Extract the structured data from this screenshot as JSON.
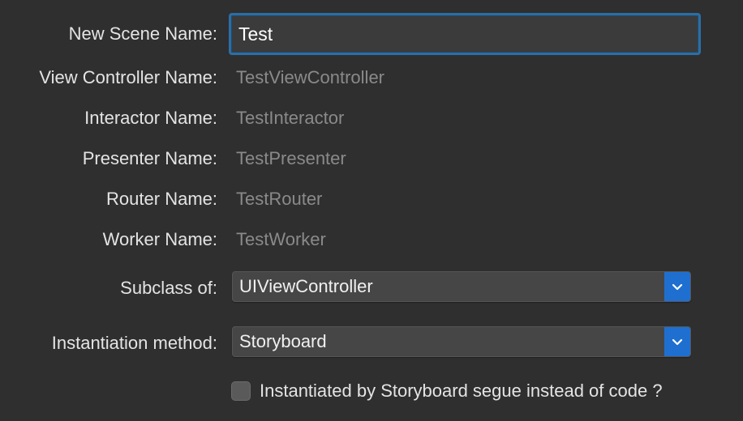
{
  "form": {
    "scene_name": {
      "label": "New Scene Name:",
      "value": "Test"
    },
    "view_controller": {
      "label": "View Controller Name:",
      "value": "TestViewController"
    },
    "interactor": {
      "label": "Interactor Name:",
      "value": "TestInteractor"
    },
    "presenter": {
      "label": "Presenter Name:",
      "value": "TestPresenter"
    },
    "router": {
      "label": "Router Name:",
      "value": "TestRouter"
    },
    "worker": {
      "label": "Worker Name:",
      "value": "TestWorker"
    },
    "subclass": {
      "label": "Subclass of:",
      "value": "UIViewController"
    },
    "instantiation": {
      "label": "Instantiation method:",
      "value": "Storyboard"
    },
    "segue_checkbox": {
      "label": "Instantiated by Storyboard segue instead of code ?",
      "checked": false
    }
  },
  "colors": {
    "background": "#2f2f2f",
    "focus_ring": "#2d6ea3",
    "popup_accent": "#1f6fd1"
  },
  "icons": {
    "popup_arrow": "chevron-down-icon"
  }
}
